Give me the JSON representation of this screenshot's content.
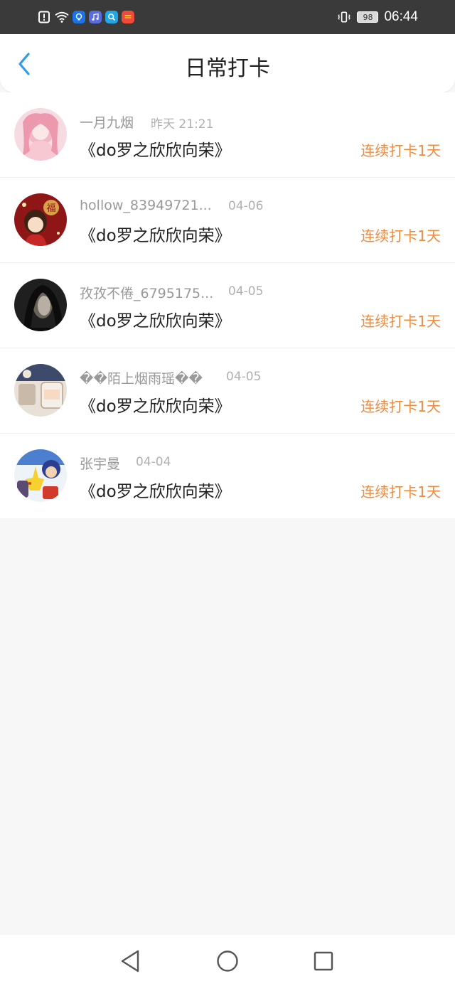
{
  "status_bar": {
    "battery": "98",
    "time": "06:44",
    "notification_icons": [
      "alert-icon",
      "wifi-icon",
      "bulb-app-icon",
      "music-app-icon",
      "search-app-icon",
      "gallery-app-icon"
    ],
    "colors": {
      "bar": "#3a3a3a"
    }
  },
  "header": {
    "title": "日常打卡",
    "back_icon": "chevron-left-icon",
    "colors": {
      "back": "#2f9ee6"
    }
  },
  "checkins": [
    {
      "name": "一月九烟",
      "date": "昨天 21:21",
      "book": "《do罗之欣欣向荣》",
      "streak": "连续打卡1天",
      "avatar_color": "#f2c9d2"
    },
    {
      "name": "hollow_83949721...",
      "date": "04-06",
      "book": "《do罗之欣欣向荣》",
      "streak": "连续打卡1天",
      "avatar_color": "#9b1b1b"
    },
    {
      "name": "孜孜不倦_6795175...",
      "date": "04-05",
      "book": "《do罗之欣欣向荣》",
      "streak": "连续打卡1天",
      "avatar_color": "#2a2a2a"
    },
    {
      "name": "��陌上烟雨瑶��",
      "date": "04-05",
      "book": "《do罗之欣欣向荣》",
      "streak": "连续打卡1天",
      "avatar_color": "#d9cfc4"
    },
    {
      "name": "张宇曼",
      "date": "04-04",
      "book": "《do罗之欣欣向荣》",
      "streak": "连续打卡1天",
      "avatar_color": "#4d7fd1"
    }
  ],
  "nav_bar": {
    "icons": [
      "back-triangle-icon",
      "home-circle-icon",
      "recents-square-icon"
    ]
  },
  "colors": {
    "accent_orange": "#ee8a3c",
    "page_bg": "#f8f7f8"
  }
}
